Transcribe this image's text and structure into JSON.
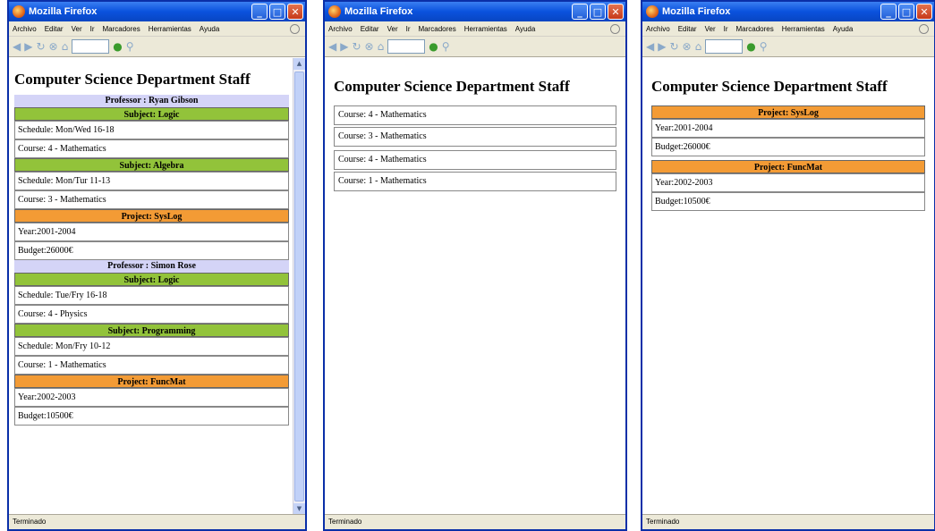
{
  "window_title": "Mozilla Firefox",
  "menu": [
    "Archivo",
    "Editar",
    "Ver",
    "Ir",
    "Marcadores",
    "Herramientas",
    "Ayuda"
  ],
  "status": "Terminado",
  "page_title": "Computer Science Department Staff",
  "window1": {
    "professors": [
      {
        "label": "Professor : Ryan Gibson",
        "subjects": [
          {
            "label": "Subject: Logic",
            "schedule": "Schedule: Mon/Wed 16-18",
            "course": "Course: 4 - Mathematics"
          },
          {
            "label": "Subject: Algebra",
            "schedule": "Schedule: Mon/Tur 11-13",
            "course": "Course: 3 - Mathematics"
          }
        ],
        "project": {
          "label": "Project: SysLog",
          "year": "Year:2001-2004",
          "budget": "Budget:26000€"
        }
      },
      {
        "label": "Professor : Simon Rose",
        "subjects": [
          {
            "label": "Subject: Logic",
            "schedule": "Schedule: Tue/Fry 16-18",
            "course": "Course: 4 - Physics"
          },
          {
            "label": "Subject: Programming",
            "schedule": "Schedule: Mon/Fry 10-12",
            "course": "Course: 1 - Mathematics"
          }
        ],
        "project": {
          "label": "Project: FuncMat",
          "year": "Year:2002-2003",
          "budget": "Budget:10500€"
        }
      }
    ]
  },
  "window2": {
    "courses": [
      "Course: 4 - Mathematics",
      "Course: 3 - Mathematics",
      "Course: 4 - Mathematics",
      "Course: 1 - Mathematics"
    ]
  },
  "window3": {
    "projects": [
      {
        "label": "Project: SysLog",
        "year": "Year:2001-2004",
        "budget": "Budget:26000€"
      },
      {
        "label": "Project: FuncMat",
        "year": "Year:2002-2003",
        "budget": "Budget:10500€"
      }
    ]
  },
  "colors": {
    "professor_bg": "#d4d4f7",
    "subject_bg": "#92c33a",
    "project_bg": "#f39b35",
    "titlebar": "#0a52dd"
  },
  "icons": [
    "firefox-icon",
    "back-icon",
    "forward-icon",
    "reload-icon",
    "stop-icon",
    "home-icon",
    "go-icon",
    "search-icon"
  ]
}
